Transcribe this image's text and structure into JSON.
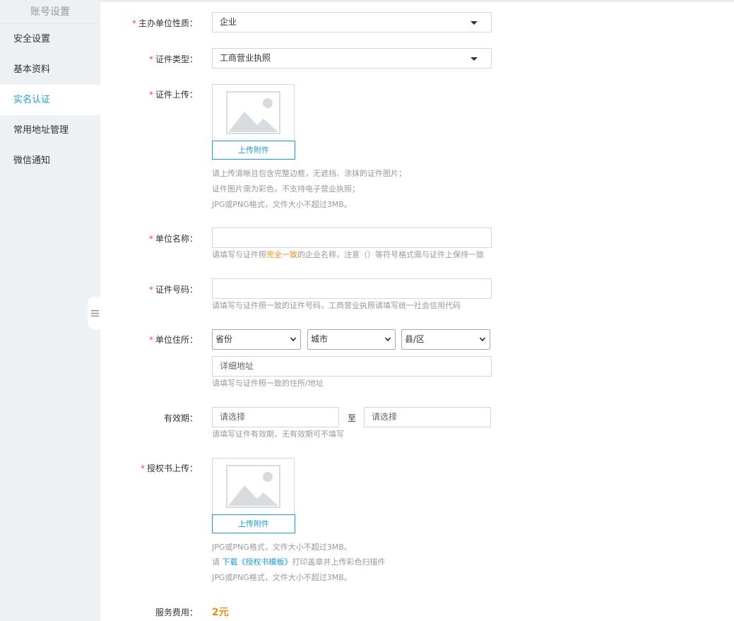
{
  "sidebar": {
    "title": "账号设置",
    "items": [
      {
        "label": "安全设置"
      },
      {
        "label": "基本资料"
      },
      {
        "label": "实名认证"
      },
      {
        "label": "常用地址管理"
      },
      {
        "label": "微信通知"
      }
    ],
    "active_index": 2
  },
  "colors": {
    "accent": "#1a9cd6",
    "required": "#e84b3c",
    "highlight": "#f08a1b"
  },
  "form": {
    "org_type": {
      "label": "主办单位性质：",
      "value": "企业"
    },
    "cert_type": {
      "label": "证件类型：",
      "value": "工商营业执照"
    },
    "cert_upload": {
      "label": "证件上传：",
      "button": "上传附件",
      "hints": [
        "请上传清晰且包含完整边框，无遮挡、涂抹的证件图片；",
        "证件图片需为彩色，不支持电子营业执照；",
        "JPG或PNG格式，文件大小不超过3MB。"
      ]
    },
    "org_name": {
      "label": "单位名称：",
      "value": "",
      "hint_pre": "请填写与证件照",
      "hint_highlight": "完全一致",
      "hint_post": "的企业名称，注意（）等符号格式需与证件上保持一致"
    },
    "cert_no": {
      "label": "证件号码：",
      "value": "",
      "hint": "请填写与证件照一致的证件号码，工商营业执照请填写统一社会信用代码"
    },
    "address": {
      "label": "单位住所：",
      "province": "省份",
      "city": "城市",
      "district": "县/区",
      "detail_placeholder": "详细地址",
      "hint": "请填写与证件照一致的住所/地址"
    },
    "validity": {
      "label": "有效期：",
      "start_placeholder": "请选择",
      "to": "至",
      "end_placeholder": "请选择",
      "hint": "请填写证件有效期，无有效期可不填写"
    },
    "auth_upload": {
      "label": "授权书上传：",
      "button": "上传附件",
      "hint1": "JPG或PNG格式，文件大小不超过3MB。",
      "hint2_pre": "请 ",
      "hint2_link": "下载《授权书模板》",
      "hint2_post": "打印盖章并上传彩色扫描件",
      "hint3": "JPG或PNG格式，文件大小不超过3MB。"
    },
    "fee": {
      "label": "服务费用：",
      "value": "2元"
    }
  }
}
